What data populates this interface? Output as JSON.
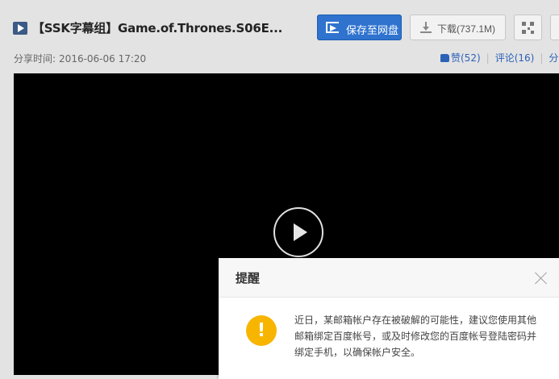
{
  "file": {
    "title": "【SSK字幕组】Game.of.Thrones.S06E..."
  },
  "toolbar": {
    "save_label": "保存至网盘",
    "download_label": "下载(737.1M)"
  },
  "meta": {
    "share_time_label": "分享时间:",
    "share_time_value": "2016-06-06 17:20",
    "like_label": "赞(52)",
    "comment_label": "评论(16)",
    "share_label": "分"
  },
  "icons": {
    "file": "video-file-icon",
    "save": "save-to-cloud-icon",
    "download": "download-icon",
    "qr": "qr-code-icon",
    "like": "thumbs-up-icon",
    "play": "play-icon",
    "close": "close-icon",
    "warning": "warning-icon"
  },
  "colors": {
    "primary": "#2f73cf",
    "link": "#2c61b8",
    "warning": "#f7b500",
    "video_bg": "#000000"
  },
  "dialog": {
    "title": "提醒",
    "warning_symbol": "!",
    "message": "近日，某邮箱帐户存在被破解的可能性，建议您使用其他邮箱绑定百度帐号，或及时修改您的百度帐号登陆密码并绑定手机，以确保帐户安全。"
  }
}
